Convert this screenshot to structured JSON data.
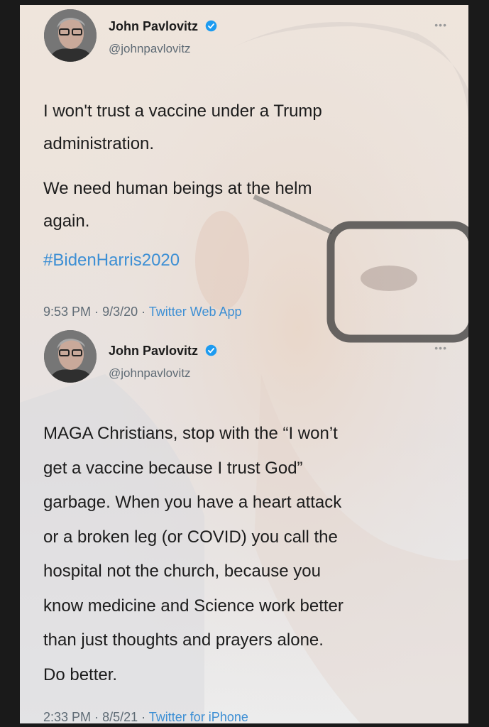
{
  "tweets": [
    {
      "display_name": "John Pavlovitz",
      "handle": "@johnpavlovitz",
      "paragraphs": [
        [
          "I won't trust a vaccine under a Trump",
          "administration."
        ],
        [
          "We need human beings at the helm",
          "again."
        ]
      ],
      "hashtag": "#BidenHarris2020",
      "time": "9:53 PM",
      "date": "9/3/20",
      "source": "Twitter Web App"
    },
    {
      "display_name": "John Pavlovitz",
      "handle": "@johnpavlovitz",
      "lines": [
        "MAGA Christians, stop with the “I won’t",
        "get a vaccine because I trust God”",
        "garbage. When you have a heart attack",
        "or a broken leg (or COVID) you call the",
        "hospital not the church, because you",
        "know medicine and Science work better",
        "than just thoughts and prayers alone.",
        "Do better."
      ],
      "time": "2:33 PM",
      "date": "8/5/21",
      "source": "Twitter for iPhone"
    }
  ],
  "colors": {
    "link_blue": "#3d8fd4",
    "verified_blue": "#1d9bf0",
    "muted_text": "#5f6b75"
  },
  "icons": {
    "verified": "verified-badge-icon",
    "more": "more-options-icon"
  }
}
